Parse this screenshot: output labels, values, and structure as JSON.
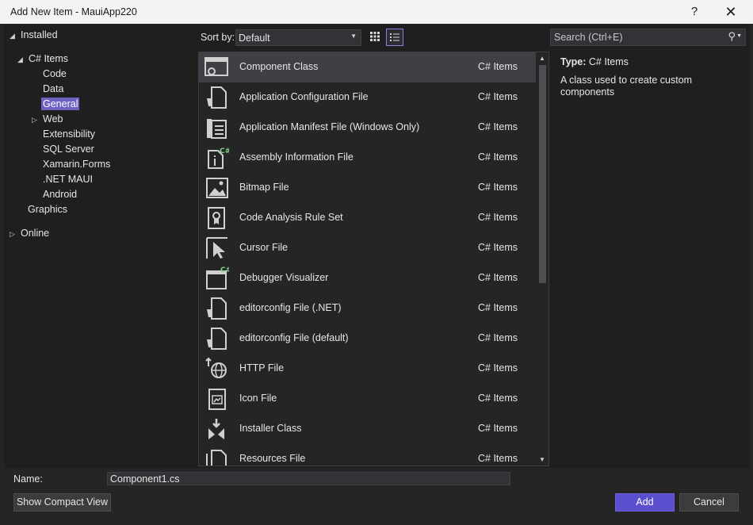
{
  "window": {
    "title": "Add New Item - MauiApp220",
    "help": "?",
    "close": "✕"
  },
  "tree": {
    "installed": "Installed",
    "csharp_items": "C# Items",
    "children": [
      "Code",
      "Data",
      "General",
      "Web",
      "Extensibility",
      "SQL Server",
      "Xamarin.Forms",
      ".NET MAUI",
      "Android"
    ],
    "graphics": "Graphics",
    "online": "Online",
    "selected": "General"
  },
  "toolbar": {
    "sort_label": "Sort by:",
    "sort_value": "Default",
    "search_placeholder": "Search (Ctrl+E)"
  },
  "items": [
    {
      "name": "Component Class",
      "category": "C# Items",
      "icon": "component-class-icon"
    },
    {
      "name": "Application Configuration File",
      "category": "C# Items",
      "icon": "config-file-icon"
    },
    {
      "name": "Application Manifest File (Windows Only)",
      "category": "C# Items",
      "icon": "manifest-file-icon"
    },
    {
      "name": "Assembly Information File",
      "category": "C# Items",
      "icon": "assembly-info-icon"
    },
    {
      "name": "Bitmap File",
      "category": "C# Items",
      "icon": "bitmap-icon"
    },
    {
      "name": "Code Analysis Rule Set",
      "category": "C# Items",
      "icon": "rule-set-icon"
    },
    {
      "name": "Cursor File",
      "category": "C# Items",
      "icon": "cursor-file-icon"
    },
    {
      "name": "Debugger Visualizer",
      "category": "C# Items",
      "icon": "debugger-visualizer-icon"
    },
    {
      "name": "editorconfig File (.NET)",
      "category": "C# Items",
      "icon": "editorconfig-icon"
    },
    {
      "name": "editorconfig File (default)",
      "category": "C# Items",
      "icon": "editorconfig-icon"
    },
    {
      "name": "HTTP File",
      "category": "C# Items",
      "icon": "http-file-icon"
    },
    {
      "name": "Icon File",
      "category": "C# Items",
      "icon": "icon-file-icon"
    },
    {
      "name": "Installer Class",
      "category": "C# Items",
      "icon": "installer-class-icon"
    },
    {
      "name": "Resources File",
      "category": "C# Items",
      "icon": "resources-file-icon"
    }
  ],
  "info": {
    "type_label": "Type:",
    "type_value": "C# Items",
    "description": "A class used to create custom components"
  },
  "footer": {
    "name_label": "Name:",
    "name_value": "Component1.cs",
    "compact_view": "Show Compact View",
    "add": "Add",
    "cancel": "Cancel"
  },
  "colors": {
    "accent": "#5b4fd0",
    "selection": "#6d61c2",
    "background": "#1f1f1f"
  }
}
